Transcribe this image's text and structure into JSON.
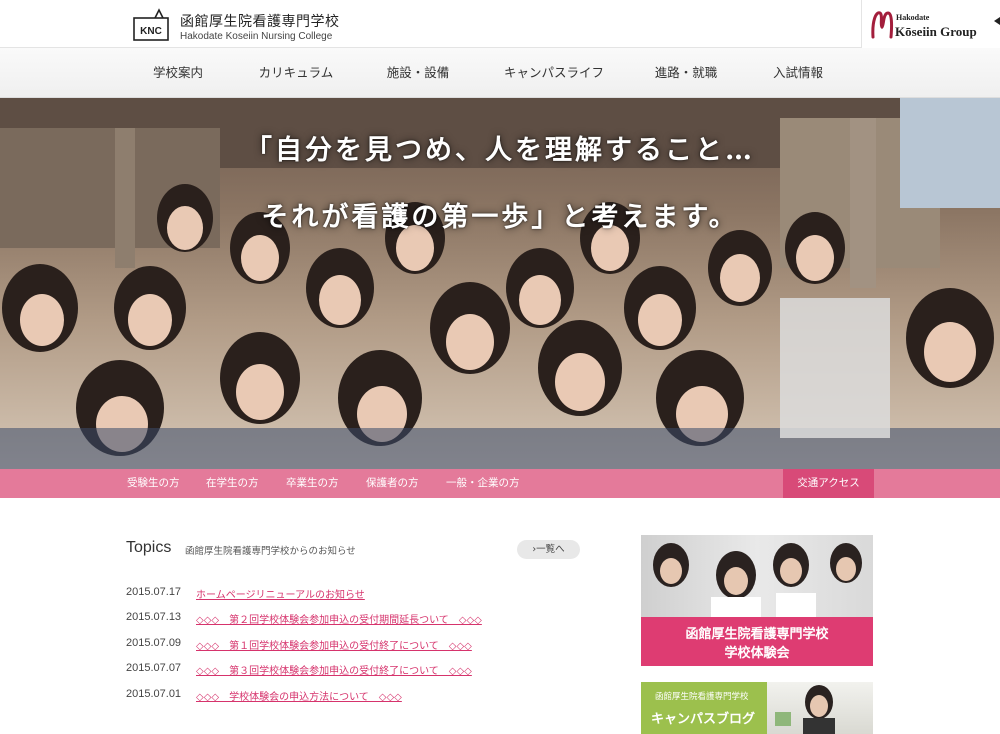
{
  "header": {
    "logo_mark": "KNC",
    "school_name": "函館厚生院看護専門学校",
    "school_name_en": "Hakodate Koseiin Nursing College",
    "group_small": "Hakodate",
    "group_name": "Kōseiin Group"
  },
  "global_nav": [
    {
      "label": "学校案内"
    },
    {
      "label": "カリキュラム"
    },
    {
      "label": "施設・設備"
    },
    {
      "label": "キャンパスライフ"
    },
    {
      "label": "進路・就職"
    },
    {
      "label": "入試情報"
    }
  ],
  "hero": {
    "line1": "「自分を見つめ、人を理解すること…",
    "line2": "それが看護の第一歩」と考えます。"
  },
  "sub_nav": [
    {
      "label": "受験生の方"
    },
    {
      "label": "在学生の方"
    },
    {
      "label": "卒業生の方"
    },
    {
      "label": "保護者の方"
    },
    {
      "label": "一般・企業の方"
    }
  ],
  "access_label": "交通アクセス",
  "topics": {
    "title": "Topics",
    "subtitle": "函館厚生院看護専門学校からのお知らせ",
    "more_label": "›一覧へ",
    "items": [
      {
        "date": "2015.07.17",
        "text": "ホームページリニューアルのお知らせ"
      },
      {
        "date": "2015.07.13",
        "text": "◇◇◇　第２回学校体験会参加申込の受付期間延長ついて　◇◇◇"
      },
      {
        "date": "2015.07.09",
        "text": "◇◇◇　第１回学校体験会参加申込の受付終了について　◇◇◇"
      },
      {
        "date": "2015.07.07",
        "text": "◇◇◇　第３回学校体験会参加申込の受付終了について　◇◇◇"
      },
      {
        "date": "2015.07.01",
        "text": "◇◇◇　学校体験会の申込方法について　◇◇◇"
      }
    ]
  },
  "banners": {
    "open_campus_line1": "函館厚生院看護専門学校",
    "open_campus_line2": "学校体験会",
    "blog_line1": "函館厚生院看護専門学校",
    "blog_line2": "キャンパスブログ"
  },
  "colors": {
    "pink_nav": "#e47a9a",
    "pink_accent": "#d84a78",
    "banner_pink": "#de3c72",
    "banner_green": "#9cc04d",
    "link": "#d6336c"
  }
}
